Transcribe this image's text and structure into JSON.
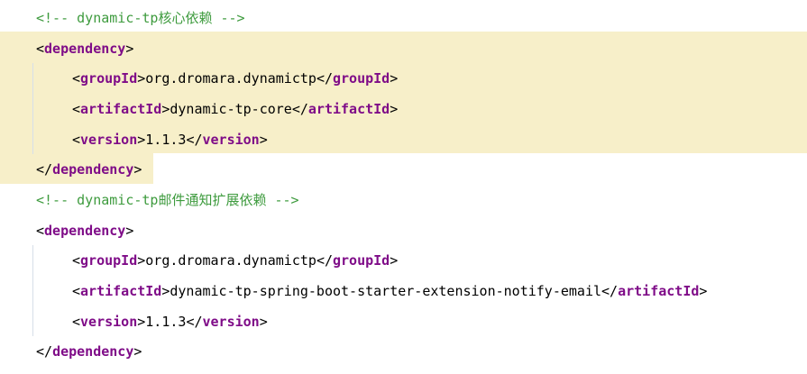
{
  "editor": {
    "lines": [
      {
        "kind": "comment",
        "indent": 0,
        "text": "<!-- dynamic-tp核心依赖 -->"
      },
      {
        "kind": "open",
        "indent": 0,
        "tag": "dependency"
      },
      {
        "kind": "element",
        "indent": 1,
        "tag": "groupId",
        "value": "org.dromara.dynamictp"
      },
      {
        "kind": "element",
        "indent": 1,
        "tag": "artifactId",
        "value": "dynamic-tp-core"
      },
      {
        "kind": "element",
        "indent": 1,
        "tag": "version",
        "value": "1.1.3"
      },
      {
        "kind": "close",
        "indent": 0,
        "tag": "dependency"
      },
      {
        "kind": "comment",
        "indent": 0,
        "text": "<!-- dynamic-tp邮件通知扩展依赖 -->"
      },
      {
        "kind": "open",
        "indent": 0,
        "tag": "dependency"
      },
      {
        "kind": "element",
        "indent": 1,
        "tag": "groupId",
        "value": "org.dromara.dynamictp"
      },
      {
        "kind": "element",
        "indent": 1,
        "tag": "artifactId",
        "value": "dynamic-tp-spring-boot-starter-extension-notify-email"
      },
      {
        "kind": "element",
        "indent": 1,
        "tag": "version",
        "value": "1.1.3"
      },
      {
        "kind": "close",
        "indent": 0,
        "tag": "dependency"
      }
    ]
  }
}
